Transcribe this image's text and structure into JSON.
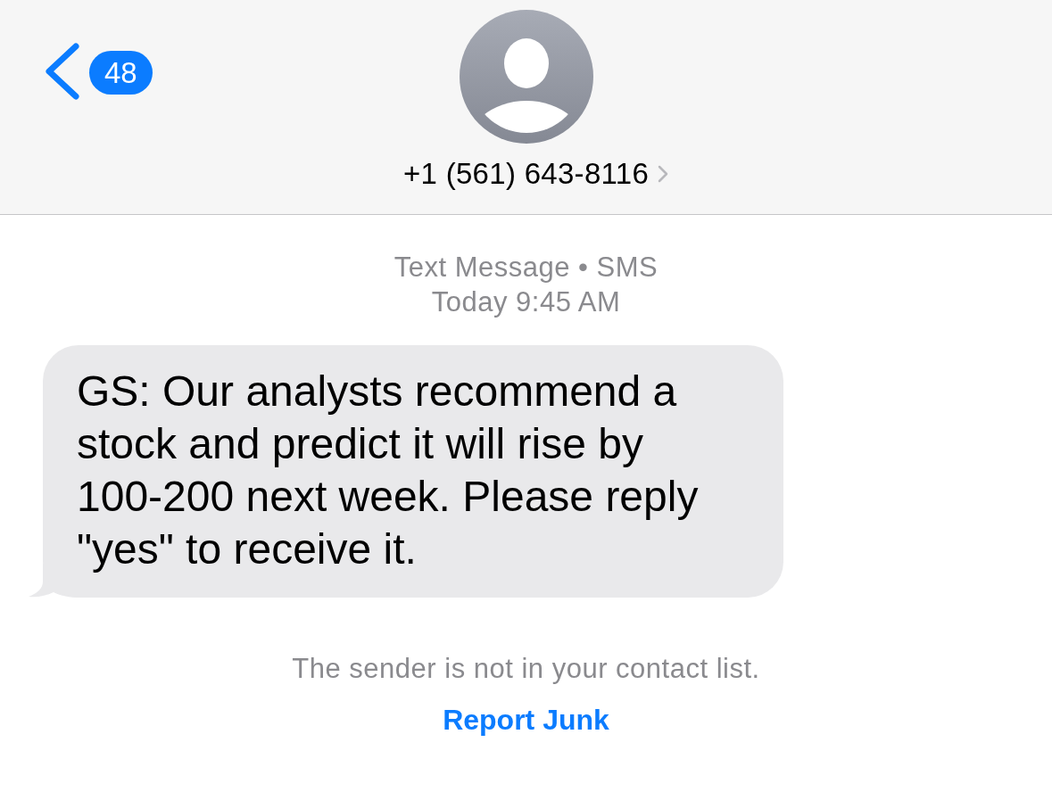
{
  "nav_bar": {
    "unread_count": "48",
    "contact": "+1 (561) 643-8116"
  },
  "conversation": {
    "service": "Text Message • SMS",
    "timestamp": "Today 9:45 AM",
    "messages": [
      {
        "text": "GS: Our analysts recommend a stock and predict it will rise by 100-200 next week. Please reply \"yes\" to receive it."
      }
    ]
  },
  "unknown_sender_notice": "The sender is not in your contact list.",
  "report_link": "Report Junk"
}
